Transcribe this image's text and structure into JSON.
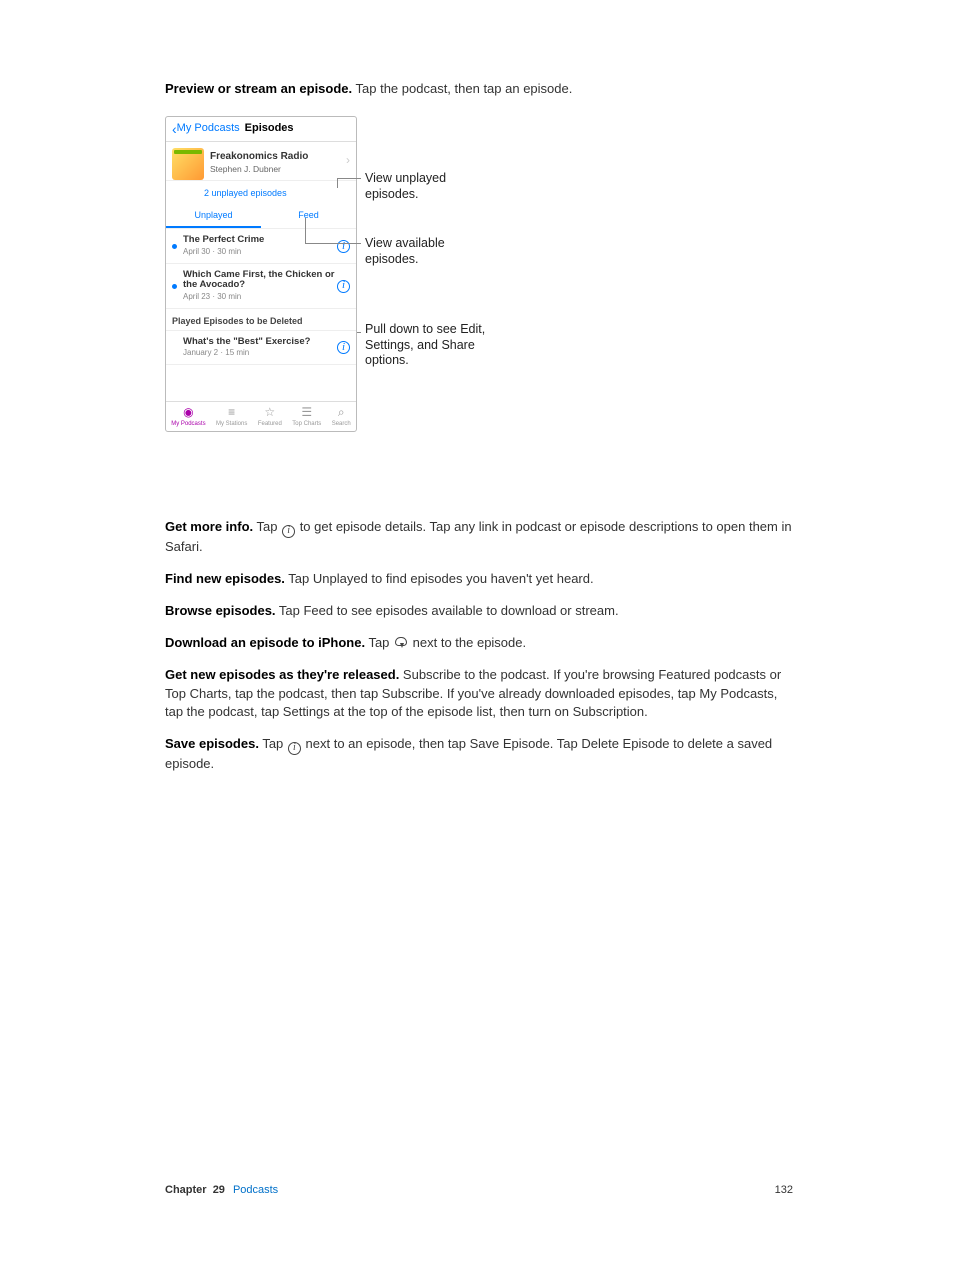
{
  "intro": {
    "heading_bold": "Preview or stream an episode.",
    "heading_rest": " Tap the podcast, then tap an episode."
  },
  "phone": {
    "back_label": "My Podcasts",
    "nav_title": "Episodes",
    "podcast_title": "Freakonomics Radio",
    "podcast_author": "Stephen J. Dubner",
    "unplayed_line": "2 unplayed episodes",
    "seg_unplayed": "Unplayed",
    "seg_feed": "Feed",
    "episodes": [
      {
        "dot": true,
        "title": "The Perfect Crime",
        "meta": "April 30 · 30 min"
      },
      {
        "dot": true,
        "title": "Which Came First, the Chicken or the Avocado?",
        "meta": "April 23 · 30 min"
      }
    ],
    "section_header": "Played Episodes to be Deleted",
    "played_episode": {
      "title": "What's the \"Best\" Exercise?",
      "meta": "January 2 · 15 min"
    },
    "tabs": [
      "My Podcasts",
      "My Stations",
      "Featured",
      "Top Charts",
      "Search"
    ]
  },
  "callouts": {
    "c1": "View unplayed episodes.",
    "c2": "View available episodes.",
    "c3": "Pull down to see Edit, Settings, and Share options."
  },
  "body": [
    {
      "bold": "Get more info.",
      "pre": " Tap ",
      "icon": "info",
      "post": " to get episode details. Tap any link in podcast or episode descriptions to open them in Safari."
    },
    {
      "bold": "Find new episodes.",
      "pre": " Tap Unplayed to find episodes you haven't yet heard.",
      "icon": "",
      "post": ""
    },
    {
      "bold": "Browse episodes.",
      "pre": " Tap Feed to see episodes available to download or stream.",
      "icon": "",
      "post": ""
    },
    {
      "bold": "Download an episode to iPhone.",
      "pre": " Tap ",
      "icon": "cloud",
      "post": " next to the episode."
    },
    {
      "bold": "Get new episodes as they're released.",
      "pre": " Subscribe to the podcast. If you're browsing Featured podcasts or Top Charts, tap the podcast, then tap Subscribe. If you've already downloaded episodes, tap My Podcasts, tap the podcast, tap Settings at the top of the episode list, then turn on Subscription.",
      "icon": "",
      "post": ""
    },
    {
      "bold": "Save episodes.",
      "pre": " Tap ",
      "icon": "info",
      "post": " next to an episode, then tap Save Episode. Tap Delete Episode to delete a saved episode."
    }
  ],
  "footer": {
    "chapter_label": "Chapter",
    "chapter_number": "29",
    "chapter_title": "Podcasts",
    "page_number": "132"
  }
}
